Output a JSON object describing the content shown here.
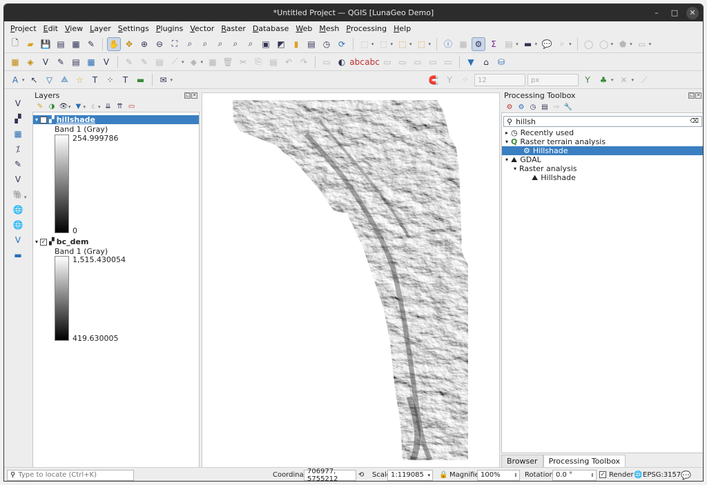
{
  "window": {
    "title": "*Untitled Project — QGIS [LunaGeo Demo]",
    "minimize": "–",
    "maximize": "□",
    "close": "✕"
  },
  "menu": [
    {
      "first": "P",
      "rest": "roject"
    },
    {
      "first": "E",
      "rest": "dit"
    },
    {
      "first": "V",
      "rest": "iew"
    },
    {
      "first": "L",
      "rest": "ayer"
    },
    {
      "first": "S",
      "rest": "ettings"
    },
    {
      "first": "P",
      "rest": "lugins"
    },
    {
      "first": "V",
      "rest": "ector"
    },
    {
      "first": "R",
      "rest": "aster"
    },
    {
      "first": "D",
      "rest": "atabase"
    },
    {
      "first": "W",
      "rest": "eb"
    },
    {
      "first": "M",
      "rest": "esh"
    },
    {
      "first": "P",
      "rest": "rocessing"
    },
    {
      "first": "H",
      "rest": "elp"
    }
  ],
  "toolbar3": {
    "snap_tolerance": "12",
    "snap_unit": "px"
  },
  "layers_panel": {
    "title": "Layers",
    "layers": [
      {
        "name": "hillshade",
        "band": "Band 1 (Gray)",
        "max": "254.999786",
        "min": "0"
      },
      {
        "name": "bc_dem",
        "band": "Band 1 (Gray)",
        "max": "1,515.430054",
        "min": "419.630005"
      }
    ]
  },
  "processing": {
    "title": "Processing Toolbox",
    "search_value": "hillsh",
    "recently_used": "Recently used",
    "group1": "Raster terrain analysis",
    "item1": "Hillshade",
    "group2": "GDAL",
    "subgroup2": "Raster analysis",
    "item2": "Hillshade",
    "tabs": [
      "Browser",
      "Processing Toolbox"
    ]
  },
  "status": {
    "locate_placeholder": "Type to locate (Ctrl+K)",
    "coordinate_label": "Coordinate",
    "coordinate": "706977, 5755212",
    "scale_label": "Scale",
    "scale": "1:119085",
    "magnifier_label": "Magnifier",
    "magnifier": "100%",
    "rotation_label": "Rotation",
    "rotation": "0.0 °",
    "render_label": "Render",
    "crs": "EPSG:3157"
  }
}
